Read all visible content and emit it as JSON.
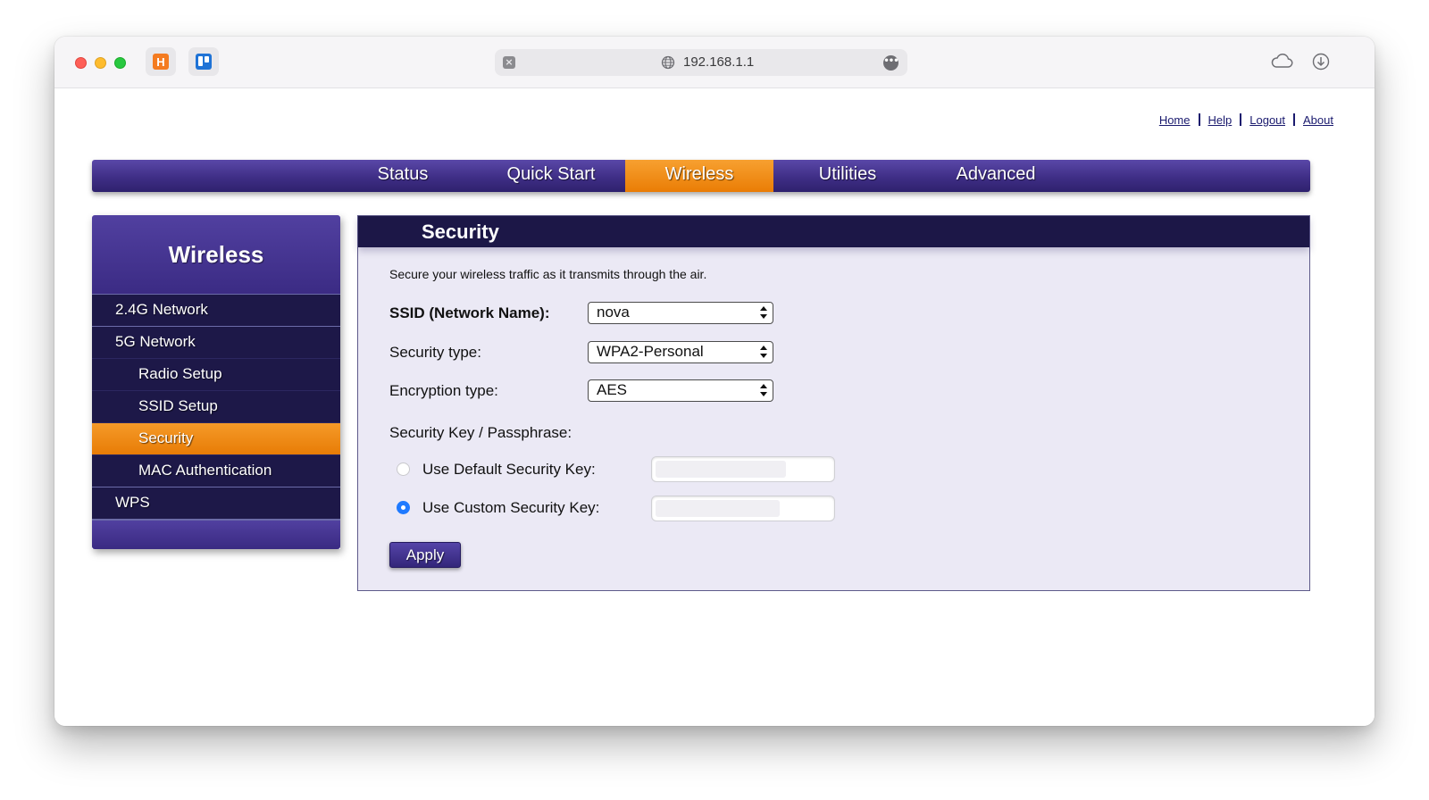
{
  "browser": {
    "url": "192.168.1.1",
    "clear_glyph": "×",
    "more_glyph": "•••",
    "extension_1_letter": "H",
    "icons": [
      "globe-icon",
      "cloud-icon",
      "download-icon",
      "harvest-extension-icon",
      "board-extension-icon"
    ]
  },
  "top_links": [
    {
      "label": "Home"
    },
    {
      "label": "Help"
    },
    {
      "label": "Logout"
    },
    {
      "label": "About"
    }
  ],
  "main_nav": {
    "tabs": [
      {
        "label": "Status"
      },
      {
        "label": "Quick Start"
      },
      {
        "label": "Wireless",
        "active": true
      },
      {
        "label": "Utilities"
      },
      {
        "label": "Advanced"
      }
    ],
    "accent_color": "#ea7d05",
    "bar_color": "#3f2e86"
  },
  "sidebar": {
    "title": "Wireless",
    "items": [
      {
        "label": "2.4G Network"
      },
      {
        "label": "5G Network"
      },
      {
        "label": "Radio Setup"
      },
      {
        "label": "SSID Setup"
      },
      {
        "label": "Security",
        "active": true
      },
      {
        "label": "MAC Authentication"
      },
      {
        "label": "WPS"
      }
    ]
  },
  "panel": {
    "title": "Security",
    "description": "Secure your wireless traffic as it transmits through the air.",
    "ssid": {
      "label": "SSID (Network Name):",
      "value": "nova"
    },
    "security_type": {
      "label": "Security type:",
      "value": "WPA2-Personal"
    },
    "encryption_type": {
      "label": "Encryption type:",
      "value": "AES"
    },
    "passphrase_label": "Security Key / Passphrase:",
    "default_key": {
      "label": "Use Default Security Key:",
      "checked": false
    },
    "custom_key": {
      "label": "Use Custom Security Key:",
      "checked": true
    },
    "apply_label": "Apply"
  }
}
